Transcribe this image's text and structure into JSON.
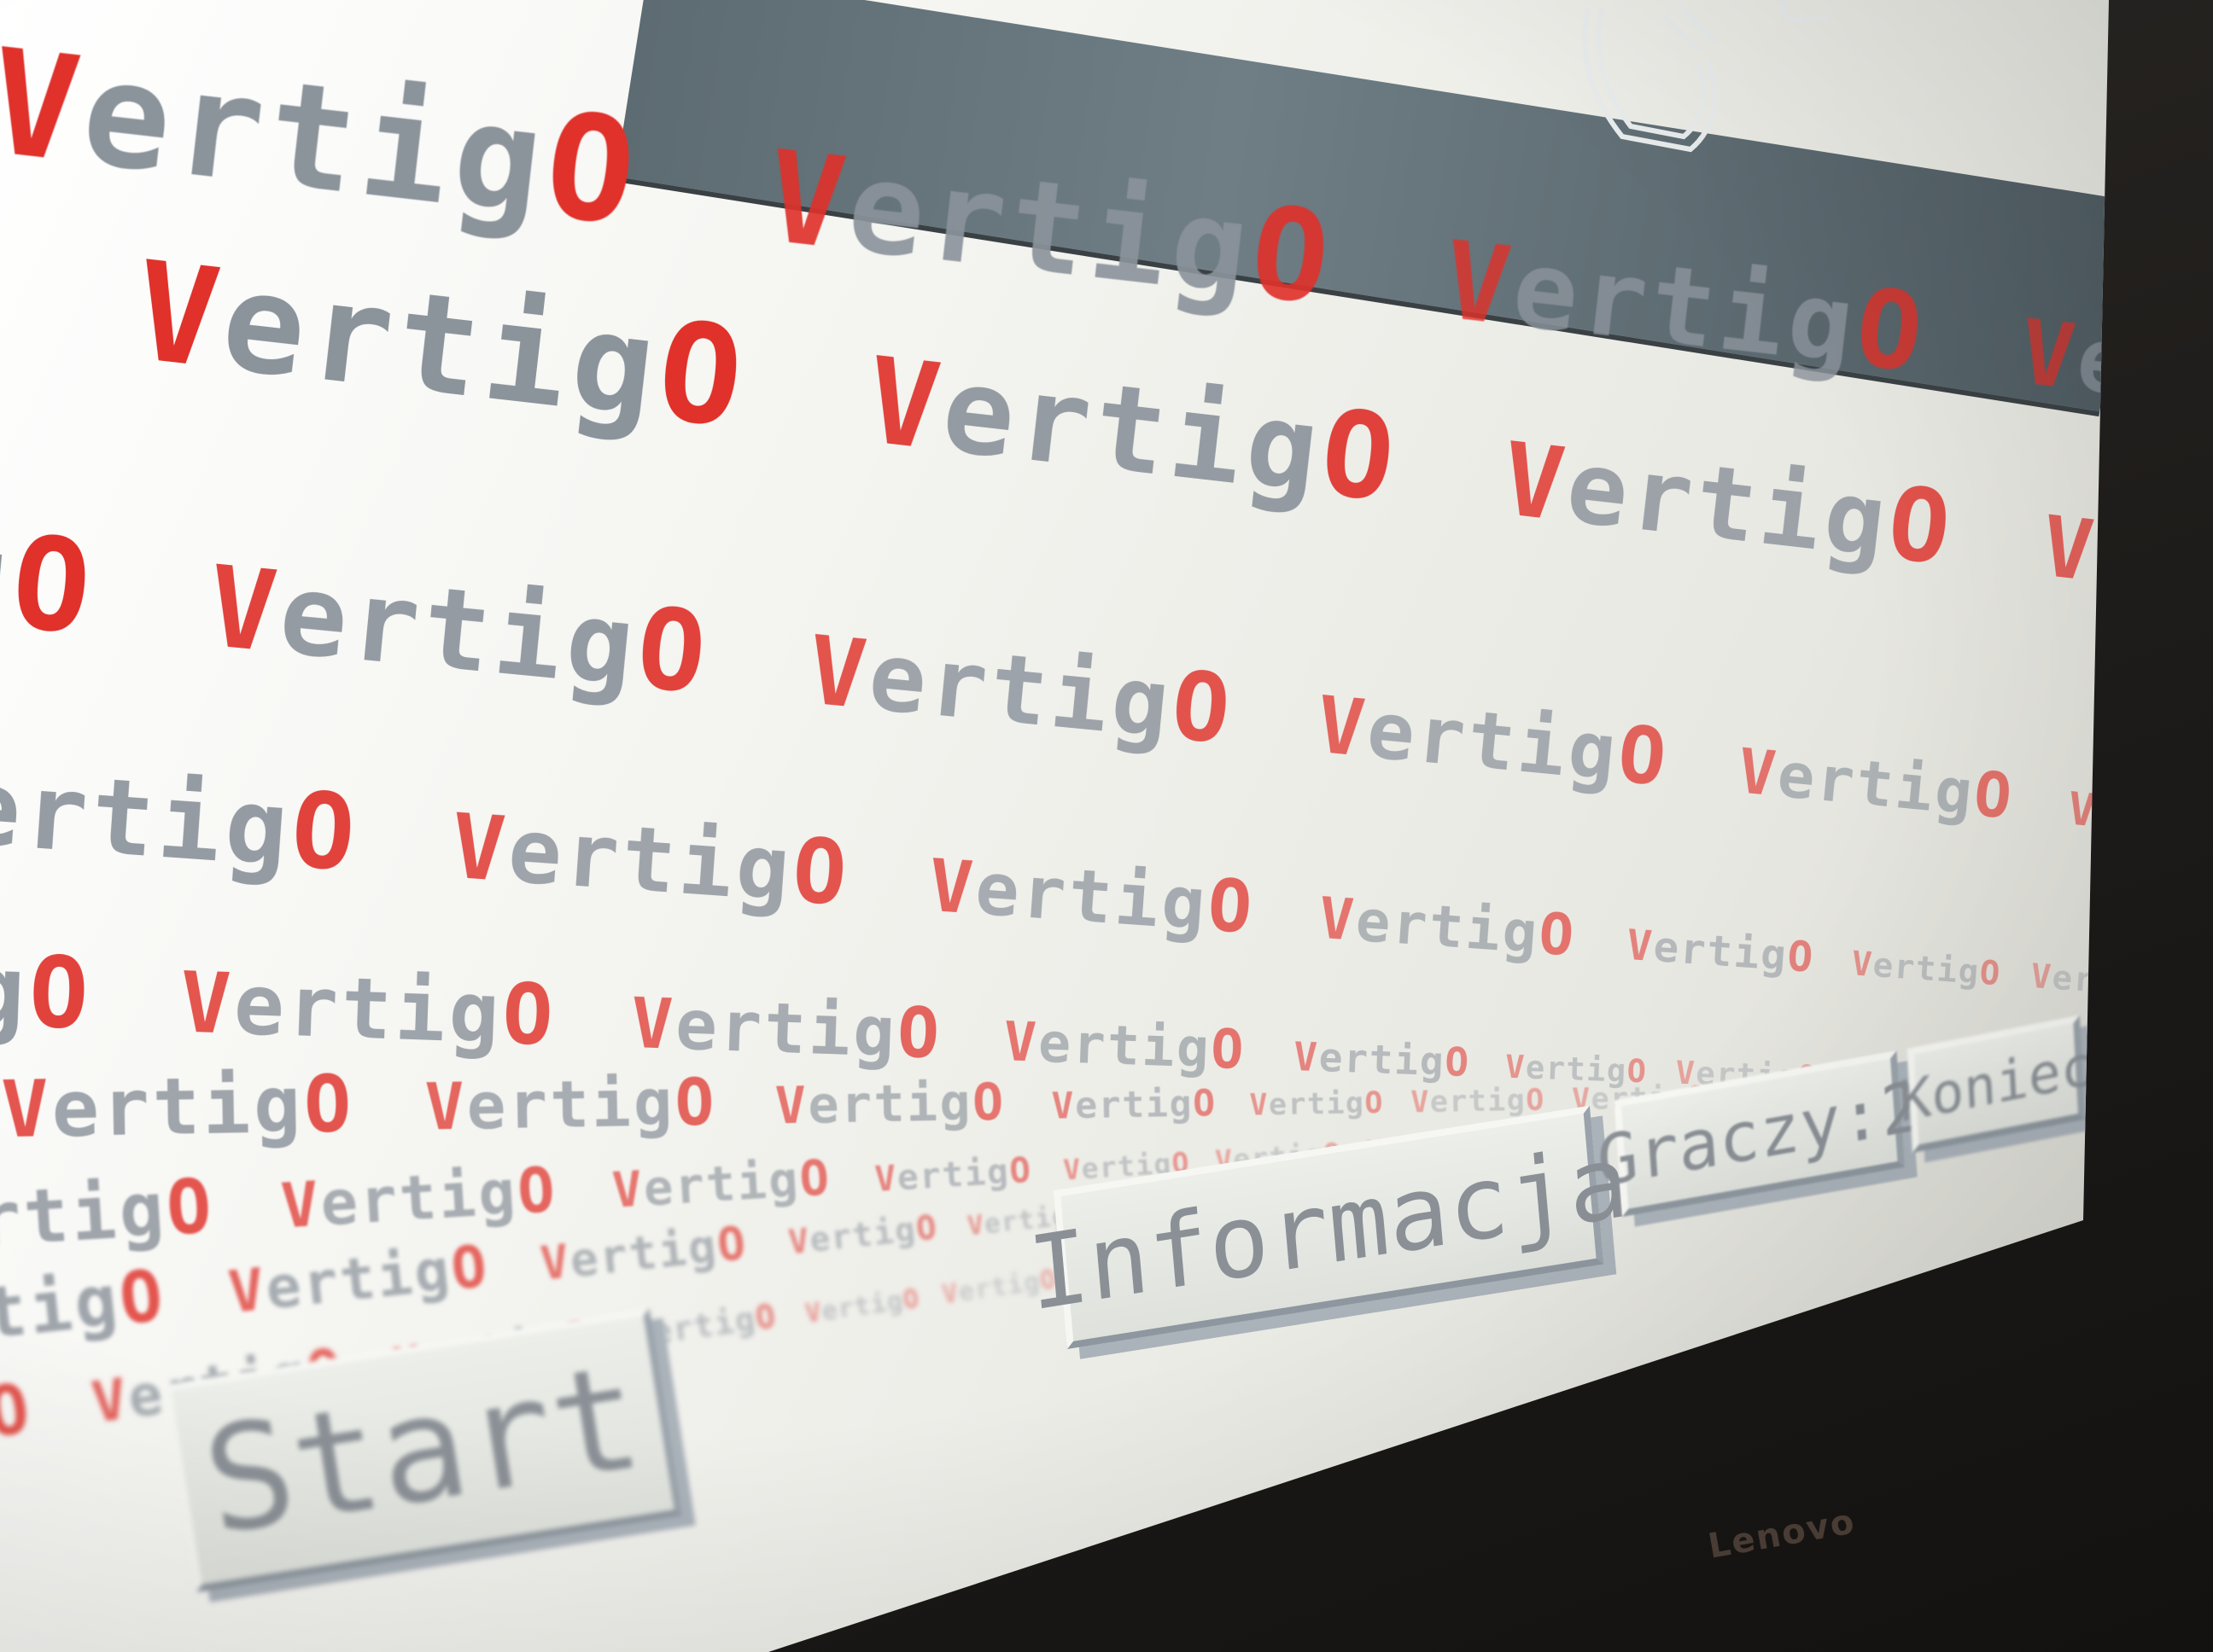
{
  "game": {
    "wordmark": "VertigO",
    "wordmark_head": "V",
    "wordmark_mid": "ertig",
    "wordmark_tail": "O"
  },
  "menu": {
    "start_label": "Start",
    "info_label": "Informacja",
    "players_label": "Graczy:2",
    "end_label": "Koniec"
  },
  "device": {
    "brand": "Lenovo"
  },
  "colors": {
    "accent_red": "#e0312a",
    "text_gray": "#8b939b",
    "background": "#f4f4f0",
    "header_slate": "#5d6b72"
  }
}
